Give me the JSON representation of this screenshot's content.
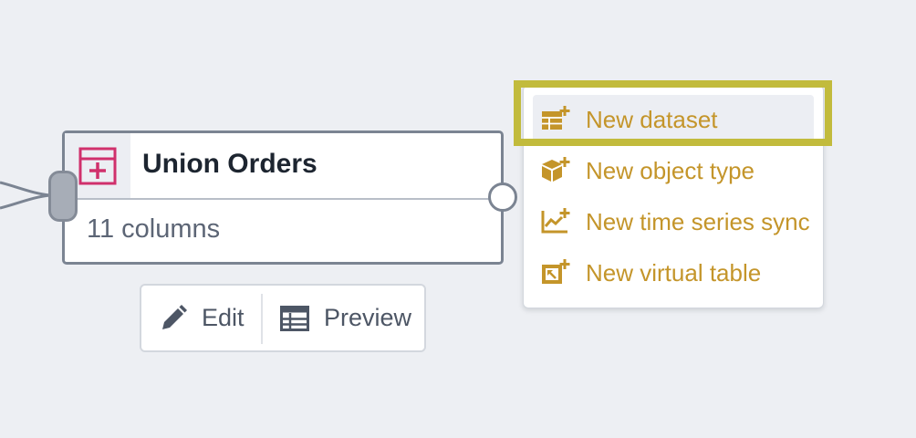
{
  "node": {
    "title": "Union Orders",
    "subtitle": "11 columns",
    "icon": "union-transform-icon",
    "icon_color": "#d0306c"
  },
  "actions": {
    "edit_label": "Edit",
    "preview_label": "Preview"
  },
  "menu": {
    "items": [
      {
        "label": "New dataset",
        "icon": "dataset-add-icon",
        "active": true
      },
      {
        "label": "New object type",
        "icon": "cube-add-icon",
        "active": false
      },
      {
        "label": "New time series sync",
        "icon": "timeline-add-icon",
        "active": false
      },
      {
        "label": "New virtual table",
        "icon": "virtual-table-add-icon",
        "active": false
      }
    ],
    "text_color": "#c4952a"
  },
  "highlight": {
    "color": "#c2bb3c"
  }
}
